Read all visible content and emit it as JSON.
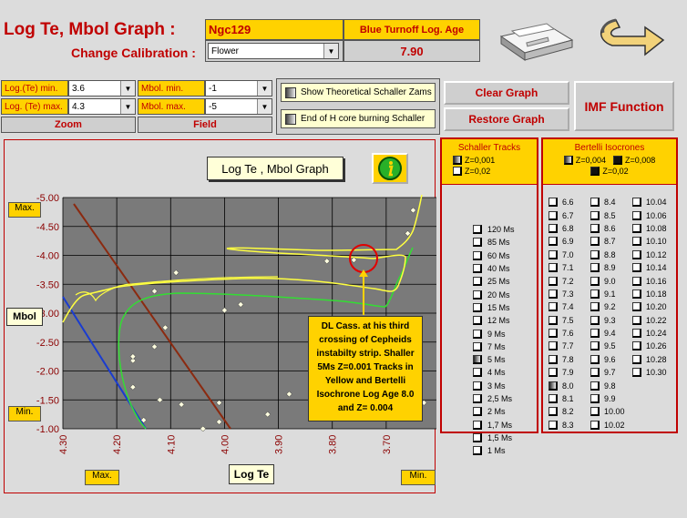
{
  "header": {
    "title": "Log Te, Mbol Graph :",
    "calibration_label": "Change Calibration :",
    "cluster_name": "Ngc129",
    "age_label": "Blue Turnoff Log. Age",
    "age_value": "7.90",
    "calibration_value": "Flower"
  },
  "zoom": {
    "logte_min_label": "Log.(Te) min.",
    "logte_min_value": "3.6",
    "logte_max_label": "Log. (Te) max.",
    "logte_max_value": "4.3",
    "zoom_button": "Zoom"
  },
  "field": {
    "mbol_min_label": "Mbol. min.",
    "mbol_min_value": "-1",
    "mbol_max_label": "Mbol. max.",
    "mbol_max_value": "-5",
    "field_button": "Field"
  },
  "toggles": {
    "zams": "Show Theoretical Schaller Zams",
    "hcore": "End of H core burning Schaller"
  },
  "buttons": {
    "clear": "Clear Graph",
    "restore": "Restore Graph",
    "imf": "IMF Function"
  },
  "chart": {
    "title": "Log Te , Mbol Graph",
    "ylabel": "Mbol",
    "xlabel": "Log Te",
    "max_top": "Max.",
    "min_left": "Min.",
    "max_bottom": "Max.",
    "min_bottom": "Min.",
    "annotation": "DL Cass. at his third crossing of Cepheids instabilty strip. Shaller 5Ms Z=0.001 Tracks in Yellow and Bertelli Isochrone Log Age 8.0 and Z= 0.004"
  },
  "chart_data": {
    "type": "scatter",
    "x_ticks": [
      "4.30",
      "4.20",
      "4.10",
      "4.00",
      "3.90",
      "3.80",
      "3.70",
      "3.60"
    ],
    "y_ticks": [
      "-5.00",
      "-4.50",
      "-4.00",
      "-3.50",
      "3.00",
      "-2.50",
      "-2.00",
      "-1.50",
      "-1.00"
    ],
    "xlim": [
      4.3,
      3.6
    ],
    "ylim": [
      -1.0,
      -5.0
    ],
    "grid": true,
    "points": [
      {
        "x": 4.15,
        "y": -1.15
      },
      {
        "x": 4.12,
        "y": -1.5
      },
      {
        "x": 4.08,
        "y": -1.42
      },
      {
        "x": 4.04,
        "y": -1.0
      },
      {
        "x": 4.01,
        "y": -1.12
      },
      {
        "x": 4.01,
        "y": -1.45
      },
      {
        "x": 3.92,
        "y": -1.25
      },
      {
        "x": 3.88,
        "y": -1.6
      },
      {
        "x": 3.63,
        "y": -1.45
      },
      {
        "x": 4.17,
        "y": -1.72
      },
      {
        "x": 4.17,
        "y": -2.18
      },
      {
        "x": 4.17,
        "y": -2.25
      },
      {
        "x": 4.13,
        "y": -2.42
      },
      {
        "x": 4.11,
        "y": -2.75
      },
      {
        "x": 4.13,
        "y": -3.38
      },
      {
        "x": 4.09,
        "y": -3.7
      },
      {
        "x": 4.0,
        "y": -3.05
      },
      {
        "x": 3.97,
        "y": -3.15
      },
      {
        "x": 3.81,
        "y": -3.9
      },
      {
        "x": 3.76,
        "y": -3.92
      },
      {
        "x": 3.65,
        "y": -4.78
      },
      {
        "x": 3.66,
        "y": -4.38
      }
    ],
    "series": [
      {
        "name": "Schaller 5Ms Z=0.001",
        "color": "#ffff40"
      },
      {
        "name": "Bertelli Isochrone Log Age 8.0 Z=0.004",
        "color": "#33dd33"
      }
    ]
  },
  "schaller": {
    "title": "Schaller Tracks",
    "z1": "Z=0,001",
    "z2": "Z=0,02",
    "tracks": [
      "120 Ms",
      "85 Ms",
      "60 Ms",
      "40 Ms",
      "25 Ms",
      "20 Ms",
      "15 Ms",
      "12 Ms",
      "9 Ms",
      "7 Ms",
      "5 Ms",
      "4 Ms",
      "3 Ms",
      "2,5 Ms",
      "2 Ms",
      "1,7 Ms",
      "1,5 Ms",
      "1 Ms"
    ],
    "checked": "5 Ms"
  },
  "bertelli": {
    "title": "Bertelli Isocrones",
    "z1": "Z=0,004",
    "z2": "Z=0,008",
    "z3": "Z=0,02",
    "col1": [
      "6.6",
      "6.7",
      "6.8",
      "6.9",
      "7.0",
      "7.1",
      "7.2",
      "7.3",
      "7.4",
      "7.5",
      "7.6",
      "7.7",
      "7.8",
      "7.9",
      "8.0",
      "8.1",
      "8.2",
      "8.3"
    ],
    "col2": [
      "8.4",
      "8.5",
      "8.6",
      "8.7",
      "8.8",
      "8.9",
      "9.0",
      "9.1",
      "9.2",
      "9.3",
      "9.4",
      "9.5",
      "9.6",
      "9.7",
      "9.8",
      "9.9",
      "10.00",
      "10.02"
    ],
    "col3": [
      "10.04",
      "10.06",
      "10.08",
      "10.10",
      "10.12",
      "10.14",
      "10.16",
      "10.18",
      "10.20",
      "10.22",
      "10.24",
      "10.26",
      "10.28",
      "10.30"
    ],
    "checked": "8.0"
  }
}
